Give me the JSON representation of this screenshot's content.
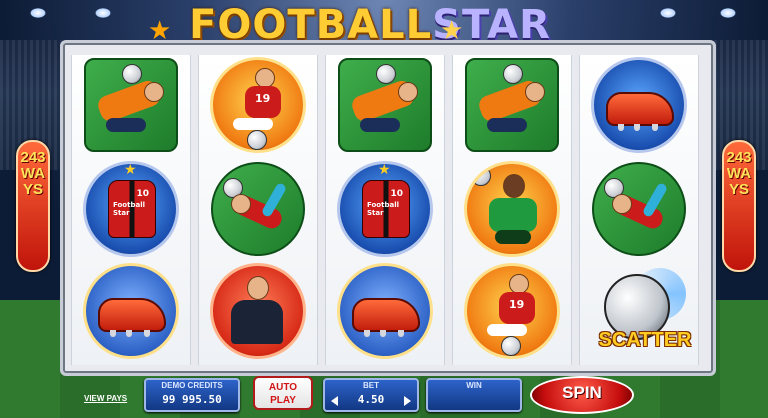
{
  "logo": {
    "part1": "FOOTBALL",
    "part2": "STAR"
  },
  "ways": {
    "left": "243WAYS",
    "right": "243WAYS"
  },
  "symbols": {
    "scatter_label": "SCATTER",
    "shirt_number": "10",
    "shirt_text": "Football Star",
    "striker_number": "19"
  },
  "reels": [
    [
      "goalkeeper",
      "shirt",
      "boot"
    ],
    [
      "striker",
      "bicycle-kick",
      "coach"
    ],
    [
      "goalkeeper",
      "shirt",
      "boot"
    ],
    [
      "goalkeeper",
      "defender",
      "striker"
    ],
    [
      "boot",
      "bicycle-kick",
      "scatter"
    ]
  ],
  "controls": {
    "view_pays": "VIEW PAYS",
    "demo_credits_label": "DEMO CREDITS",
    "demo_credits_value": "99 995.50",
    "autoplay_line1": "AUTO",
    "autoplay_line2": "PLAY",
    "bet_label": "BET",
    "bet_value": "4.50",
    "win_label": "WIN",
    "win_value": "",
    "spin": "SPIN"
  },
  "colors": {
    "accent_red": "#d11414",
    "panel_blue": "#123884",
    "gold": "#ffcc33"
  }
}
